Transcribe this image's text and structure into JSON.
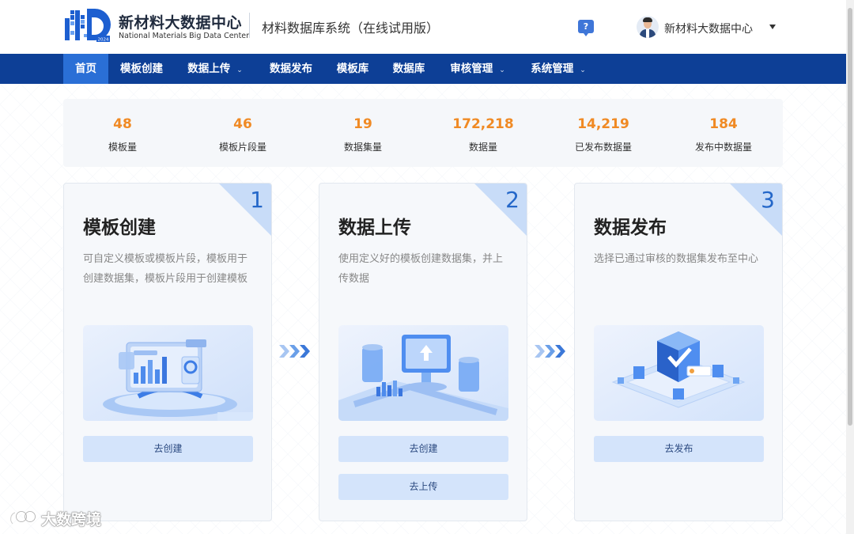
{
  "header": {
    "brand_cn": "新材料大数据中心",
    "brand_en": "National Materials Big Data Center",
    "system_title": "材料数据库系统（在线试用版）",
    "help_icon": "?",
    "user_name": "新材料大数据中心",
    "logo_year": "2024"
  },
  "nav": {
    "items": [
      {
        "label": "首页",
        "active": true
      },
      {
        "label": "模板创建"
      },
      {
        "label": "数据上传",
        "dropdown": "⌄"
      },
      {
        "label": "数据发布"
      },
      {
        "label": "模板库"
      },
      {
        "label": "数据库"
      },
      {
        "label": "审核管理",
        "dropdown": "⌄"
      },
      {
        "label": "系统管理",
        "dropdown": "⌄"
      }
    ]
  },
  "stats": [
    {
      "value": "48",
      "label": "模板量"
    },
    {
      "value": "46",
      "label": "模板片段量"
    },
    {
      "value": "19",
      "label": "数据集量"
    },
    {
      "value": "172,218",
      "label": "数据量"
    },
    {
      "value": "14,219",
      "label": "已发布数据量"
    },
    {
      "value": "184",
      "label": "发布中数据量"
    }
  ],
  "cards": [
    {
      "number": "1",
      "title": "模板创建",
      "desc": "可自定义模板或模板片段，模板用于创建数据集，模板片段用于创建模板",
      "buttons": [
        "去创建"
      ]
    },
    {
      "number": "2",
      "title": "数据上传",
      "desc": "使用定义好的模板创建数据集，并上传数据",
      "buttons": [
        "去创建",
        "去上传"
      ]
    },
    {
      "number": "3",
      "title": "数据发布",
      "desc": "选择已通过审核的数据集发布至中心",
      "buttons": [
        "去发布"
      ]
    }
  ],
  "watermark": "大数跨境",
  "colors": {
    "nav_bg": "#0d3f96",
    "nav_active": "#2a6fd6",
    "stat_value": "#f08a24",
    "card_number": "#2467c9",
    "button_bg": "#d4e4fb"
  }
}
